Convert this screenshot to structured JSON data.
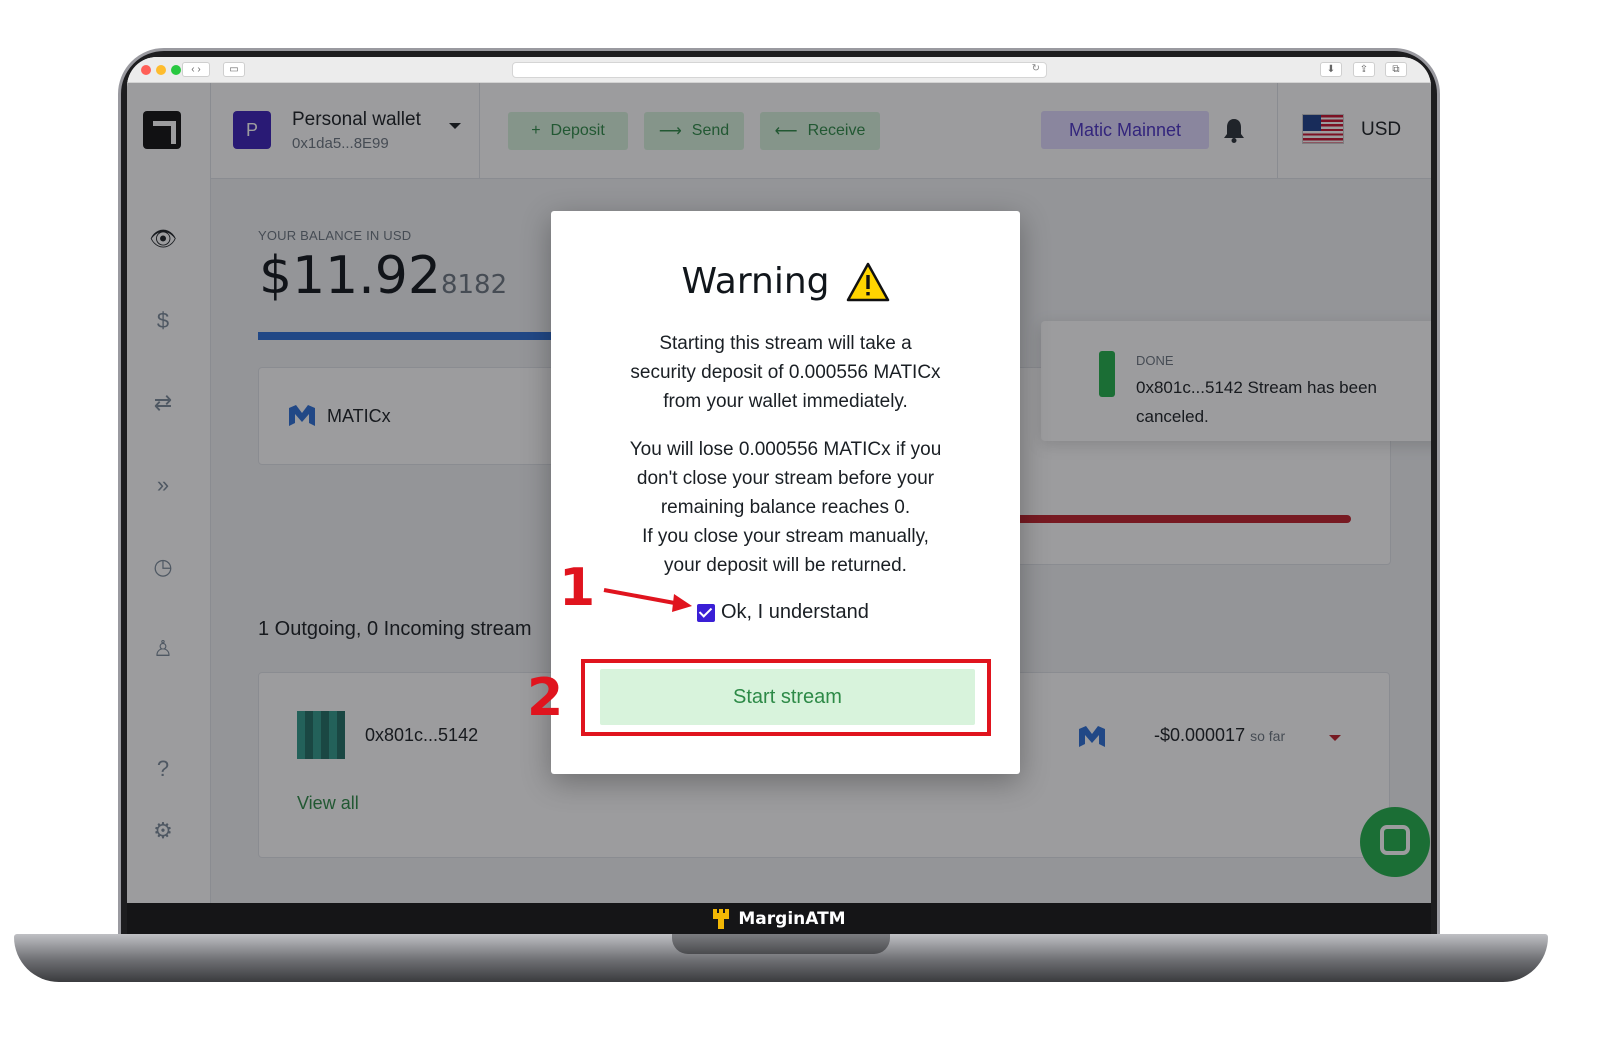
{
  "wallet": {
    "avatar_letter": "P",
    "name": "Personal wallet",
    "address": "0x1da5...8E99"
  },
  "actions": {
    "deposit": "Deposit",
    "send": "Send",
    "receive": "Receive"
  },
  "network": "Matic Mainnet",
  "currency": "USD",
  "balance": {
    "label": "YOUR BALANCE IN USD",
    "main": "$11.92",
    "fraction": "8182"
  },
  "token": {
    "name": "MATICx"
  },
  "streams": {
    "summary": "1 Outgoing, 0 Incoming stream",
    "item": {
      "address": "0x801c...5142",
      "amount": "-$0.000017",
      "suffix": "so far"
    },
    "view_all": "View all"
  },
  "toast": {
    "status": "DONE",
    "message": "0x801c...5142 Stream has been canceled."
  },
  "modal": {
    "title": "Warning",
    "paragraph1": "Starting this stream will take a\nsecurity deposit of 0.000556 MATICx\nfrom your wallet immediately.",
    "paragraph2": "You will lose 0.000556 MATICx if you\ndon't close your stream before your\nremaining balance reaches 0.\nIf you close your stream manually,\nyour deposit will be returned.",
    "checkbox_label": "Ok, I understand",
    "checkbox_checked": true,
    "button": "Start stream"
  },
  "annotations": {
    "step1": "1",
    "step2": "2",
    "color": "#e0141e"
  },
  "bezel_brand": "MarginATM",
  "colors": {
    "accent_green": "#2d8a47",
    "button_green_bg": "#d8f3dc",
    "network_purple": "#4b33c5",
    "checkbox_purple": "#3a1fd6"
  }
}
